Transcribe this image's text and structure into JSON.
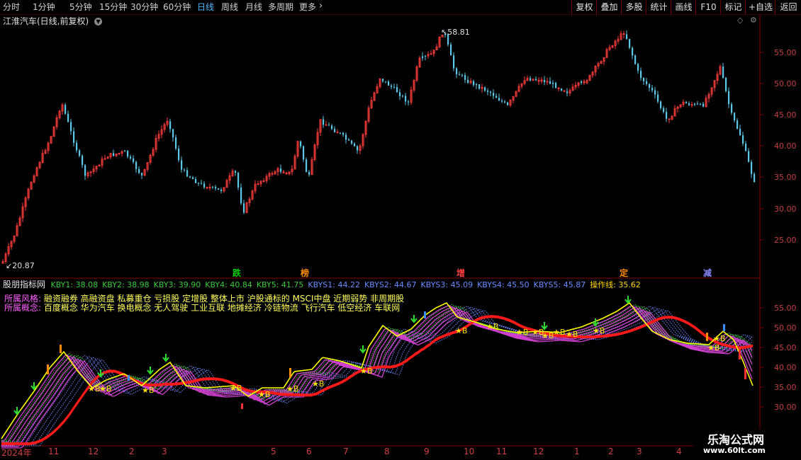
{
  "toolbar": {
    "periods": [
      "分时",
      "1分钟",
      "5分钟",
      "15分钟",
      "30分钟",
      "60分钟",
      "日线",
      "周线",
      "月线",
      "多周期",
      "更多"
    ],
    "active_period": "日线",
    "more_chevron": "›",
    "buttons": [
      "复权",
      "叠加",
      "多股",
      "统计",
      "画线",
      "F10",
      "标记",
      "+自选",
      "返回"
    ]
  },
  "main_chart": {
    "title": "江淮汽车(日线,前复权)",
    "dropdown_icon": "chevron-down-icon",
    "high_label": "58.81",
    "low_label": "20.87",
    "y_ticks": [
      "55.00",
      "50.00",
      "45.00",
      "40.00",
      "35.00",
      "30.00",
      "25.00"
    ],
    "signals": [
      {
        "text": "跌",
        "color": "#00d000"
      },
      {
        "text": "榜",
        "color": "#ff8c00"
      },
      {
        "text": "增",
        "color": "#ff4040"
      },
      {
        "text": "定",
        "color": "#ff8c00"
      },
      {
        "text": "减",
        "color": "#8888ff"
      }
    ]
  },
  "indicator": {
    "name": "股朋指标网",
    "values": [
      {
        "label": "KBY1: 38.08",
        "color": "#3cc83c"
      },
      {
        "label": "KBY2: 38.98",
        "color": "#3cc83c"
      },
      {
        "label": "KBY3: 39.90",
        "color": "#3cc83c"
      },
      {
        "label": "KBY4: 40.84",
        "color": "#3cc83c"
      },
      {
        "label": "KBY5: 41.75",
        "color": "#3cc83c"
      },
      {
        "label": "KBYS1: 44.22",
        "color": "#6a8cff"
      },
      {
        "label": "KBYS2: 44.67",
        "color": "#6a8cff"
      },
      {
        "label": "KBYS3: 45.09",
        "color": "#6a8cff"
      },
      {
        "label": "KBYS4: 45.50",
        "color": "#6a8cff"
      },
      {
        "label": "KBYS5: 45.87",
        "color": "#6a8cff"
      },
      {
        "label": "操作线: 35.62",
        "color": "#ffd700"
      }
    ],
    "style_label": "所属风格: ",
    "style_text": "融资融券 高融资盘 私募重仓 亏损股 定增股 整体上市 沪股通标的 MSCI中盘 近期弱势 非周期股",
    "concept_label": "所属概念: ",
    "concept_text": "百度概念 华为汽车 换电概念 无人驾驶 工业互联 地摊经济 冷链物流 飞行汽车 低空经济 车联网",
    "y_ticks": [
      "55.00",
      "50.00",
      "45.00",
      "40.00",
      "35.00",
      "30.00"
    ],
    "b_mark": "★B"
  },
  "x_axis": [
    "2024年",
    "11",
    "12",
    "2",
    "3",
    "5",
    "6",
    "7",
    "8",
    "9",
    "10",
    "11",
    "12",
    "1",
    "2",
    "3",
    "4"
  ],
  "watermark": {
    "line1": "乐淘公式网",
    "line2": "www.60lt.com"
  },
  "colors": {
    "up": "#ff3c3c",
    "down": "#5ac8e6",
    "frame": "#800000",
    "ops": "#ffff00",
    "red_line": "#ff1a1a"
  }
}
